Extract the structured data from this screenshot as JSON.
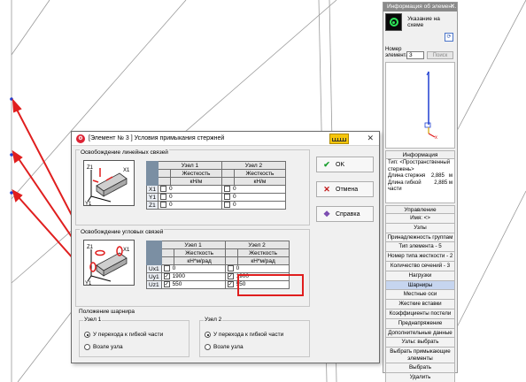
{
  "info_panel": {
    "title": "Информация об элемен...",
    "scheme_label": "Указание на схеме",
    "element_number_label": "Номер элемента",
    "element_number_value": "3",
    "search_label": "Поиск",
    "info_header": "Информация",
    "type_text": "Тип: <Пространственный стержень>",
    "rod_length_label": "Длина стержня",
    "rod_length_value": "2,885",
    "rod_length_unit": "м",
    "flex_length_label": "Длина гибкой части",
    "flex_length_value": "2,885",
    "flex_length_unit": "м",
    "mgmt_header": "Управление",
    "buttons": [
      "Имя: <>",
      "Узлы",
      "Принадлежность группам",
      "Тип элемента - 5",
      "Номер типа жесткости - 2",
      "Количество сечений - 3",
      "Нагрузки",
      "Шарниры",
      "Местные оси",
      "Жесткие вставки",
      "Коэффициенты постели",
      "Преднапряжение",
      "Дополнительные данные",
      "Узлы: выбрать",
      "Выбрать примыкающие элементы",
      "Выбрать",
      "Удалить"
    ],
    "active_button": "Шарниры"
  },
  "dialog": {
    "title": "[Элемент № 3 ] Условия примыкания стержней",
    "ok_label": "OK",
    "cancel_label": "Отмена",
    "help_label": "Справка",
    "linear": {
      "group_title": "Освобождение линейных связей",
      "node1": "Узел 1",
      "node2": "Узел 2",
      "stiffness": "Жесткость",
      "unit": "кН/м",
      "rows": [
        {
          "label": "X1",
          "node1": {
            "checked": false,
            "value": "0"
          },
          "node2": {
            "checked": false,
            "value": "0"
          }
        },
        {
          "label": "Y1",
          "node1": {
            "checked": false,
            "value": "0"
          },
          "node2": {
            "checked": false,
            "value": "0"
          }
        },
        {
          "label": "Z1",
          "node1": {
            "checked": false,
            "value": "0"
          },
          "node2": {
            "checked": false,
            "value": "0"
          }
        }
      ]
    },
    "angular": {
      "group_title": "Освобождение угловых связей",
      "node1": "Узел 1",
      "node2": "Узел 2",
      "stiffness": "Жесткость",
      "unit": "кН*м/рад",
      "rows": [
        {
          "label": "Ux1",
          "node1": {
            "checked": false,
            "value": "0"
          },
          "node2": {
            "checked": false,
            "value": "0"
          }
        },
        {
          "label": "Uy1",
          "node1": {
            "checked": true,
            "value": "1900"
          },
          "node2": {
            "checked": true,
            "value": "1900"
          }
        },
        {
          "label": "Uz1",
          "node1": {
            "checked": true,
            "value": "550"
          },
          "node2": {
            "checked": true,
            "value": "550"
          }
        }
      ]
    },
    "hinge": {
      "group_title": "Положение шарнира",
      "node1": "Узел 1",
      "node2": "Узел 2",
      "option_flex": "У перехода к гибкой части",
      "option_node": "Возле узла",
      "node1_selected": "flex",
      "node2_selected": "flex"
    }
  },
  "colors": {
    "arrow_red": "#e01e1e",
    "highlight_red": "#e01e1e",
    "rod_blue": "#1f3fd1",
    "ok_green": "#1a9e2e",
    "cancel_red": "#c01515",
    "active_button": "#c6d5ef"
  }
}
